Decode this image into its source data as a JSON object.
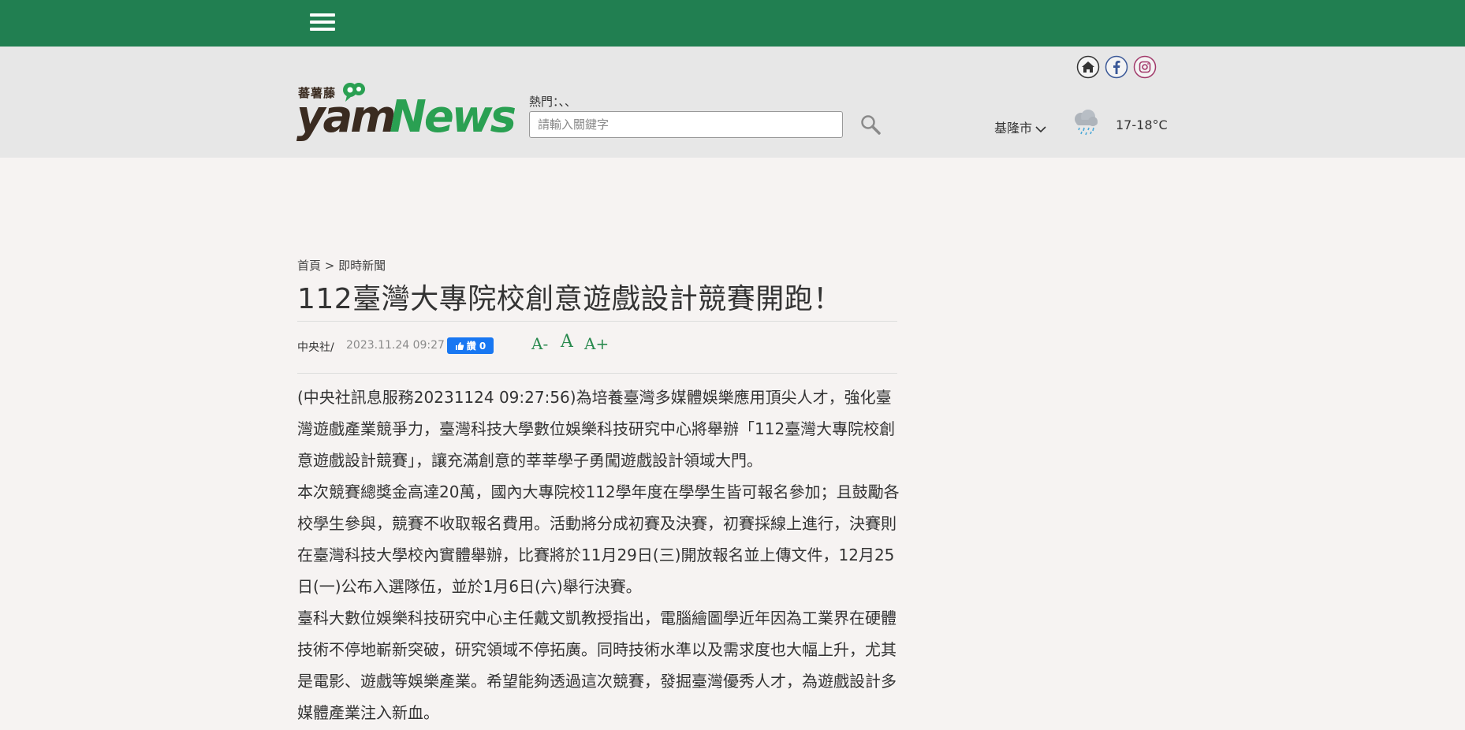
{
  "nav": {
    "menu_icon": "hamburger-menu-icon"
  },
  "logo": {
    "cn_text": "蕃薯藤",
    "yam": "yam",
    "news": "News"
  },
  "search": {
    "hot_label": "熱門：、、",
    "placeholder": "請輸入關鍵字"
  },
  "social": [
    {
      "name": "home-icon",
      "color": "#333333"
    },
    {
      "name": "facebook-icon",
      "color": "#3b5998"
    },
    {
      "name": "instagram-icon",
      "color": "#a23a6b"
    }
  ],
  "weather": {
    "city": "基隆市",
    "temp": "17-18°C",
    "icon": "rain-cloud-icon"
  },
  "breadcrumb": {
    "home": "首頁",
    "sep": ">",
    "section": "即時新聞"
  },
  "article": {
    "title": "112臺灣大專院校創意遊戲設計競賽開跑！",
    "source": "中央社/",
    "date": "2023.11.24 09:27",
    "fb_like": "讚 0",
    "font_controls": {
      "smaller": "A-",
      "normal": "A",
      "larger": "A+"
    },
    "paragraphs": [
      "(中央社訊息服務20231124 09:27:56)為培養臺灣多媒體娛樂應用頂尖人才，強化臺灣遊戲產業競爭力，臺灣科技大學數位娛樂科技研究中心將舉辦「112臺灣大專院校創意遊戲設計競賽」，讓充滿創意的莘莘學子勇闖遊戲設計領域大門。",
      "本次競賽總獎金高達20萬，國內大專院校112學年度在學學生皆可報名參加；且鼓勵各校學生參與，競賽不收取報名費用。活動將分成初賽及決賽，初賽採線上進行，決賽則在臺灣科技大學校內實體舉辦，比賽將於11月29日(三)開放報名並上傳文件，12月25日(一)公布入選隊伍，並於1月6日(六)舉行決賽。",
      "臺科大數位娛樂科技研究中心主任戴文凱教授指出，電腦繪圖學近年因為工業界在硬體技術不停地嶄新突破，研究領域不停拓廣。同時技術水準以及需求度也大幅上升，尤其是電影、遊戲等娛樂產業。希望能夠透過這次競賽，發掘臺灣優秀人才，為遊戲設計多媒體產業注入新血。"
    ]
  },
  "colors": {
    "brand_green": "#217f51",
    "logo_green": "#2aa052",
    "fb_blue": "#1877f2"
  }
}
